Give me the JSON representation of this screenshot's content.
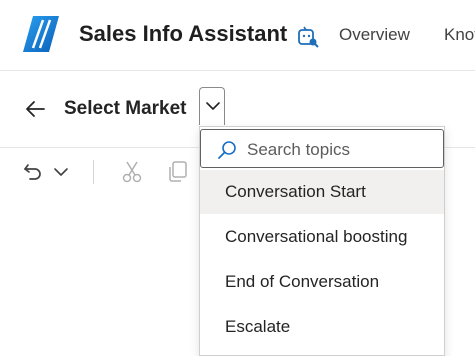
{
  "header": {
    "app_title": "Sales Info Assistant",
    "nav": [
      "Overview",
      "Knov"
    ],
    "logo_icon": "copilot-logo-icon",
    "agent_icon": "agent-config-icon"
  },
  "page": {
    "title": "Select Market"
  },
  "toolbar": {
    "icons": [
      "undo-icon",
      "chevron-down-icon",
      "cut-icon",
      "copy-icon"
    ]
  },
  "dropdown": {
    "search_placeholder": "Search topics",
    "items": [
      {
        "label": "Conversation Start",
        "active": true
      },
      {
        "label": "Conversational boosting",
        "active": false
      },
      {
        "label": "End of Conversation",
        "active": false
      },
      {
        "label": "Escalate",
        "active": false
      }
    ]
  },
  "colors": {
    "brand_blue": "#1976d2",
    "active_item_bg": "#f2f0ee",
    "border": "#e6e6e6"
  }
}
